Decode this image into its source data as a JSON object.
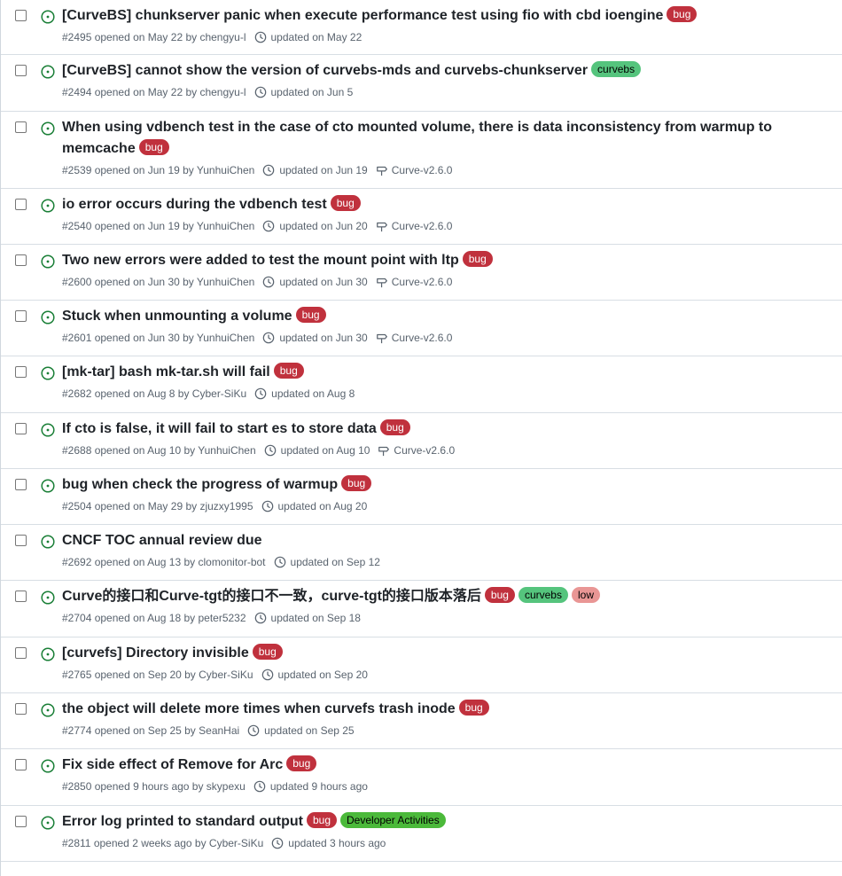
{
  "colors": {
    "open_icon": "#1a7f37",
    "bug_label_bg": "#c0313d",
    "curvebs_label_bg": "#55c47d",
    "low_label_bg": "#e99695",
    "dev_label_bg": "#4bb93a"
  },
  "issues": [
    {
      "title": "[CurveBS] chunkserver panic when execute performance test using fio with cbd ioengine",
      "labels": [
        "bug"
      ],
      "meta": "#2495 opened on May 22 by chengyu-l",
      "updated": "updated on May 22",
      "milestone": ""
    },
    {
      "title": "[CurveBS] cannot show the version of curvebs-mds and curvebs-chunkserver",
      "labels": [
        "curvebs"
      ],
      "meta": "#2494 opened on May 22 by chengyu-l",
      "updated": "updated on Jun 5",
      "milestone": ""
    },
    {
      "title": "When using vdbench test in the case of cto mounted volume, there is data inconsistency from warmup to memcache",
      "labels": [
        "bug"
      ],
      "meta": "#2539 opened on Jun 19 by YunhuiChen",
      "updated": "updated on Jun 19",
      "milestone": "Curve-v2.6.0"
    },
    {
      "title": "io error occurs during the vdbench test",
      "labels": [
        "bug"
      ],
      "meta": "#2540 opened on Jun 19 by YunhuiChen",
      "updated": "updated on Jun 20",
      "milestone": "Curve-v2.6.0"
    },
    {
      "title": "Two new errors were added to test the mount point with ltp",
      "labels": [
        "bug"
      ],
      "meta": "#2600 opened on Jun 30 by YunhuiChen",
      "updated": "updated on Jun 30",
      "milestone": "Curve-v2.6.0"
    },
    {
      "title": "Stuck when unmounting a volume",
      "labels": [
        "bug"
      ],
      "meta": "#2601 opened on Jun 30 by YunhuiChen",
      "updated": "updated on Jun 30",
      "milestone": "Curve-v2.6.0"
    },
    {
      "title": "[mk-tar] bash mk-tar.sh will fail",
      "labels": [
        "bug"
      ],
      "meta": "#2682 opened on Aug 8 by Cyber-SiKu",
      "updated": "updated on Aug 8",
      "milestone": ""
    },
    {
      "title": "If cto is false, it will fail to start es to store data",
      "labels": [
        "bug"
      ],
      "meta": "#2688 opened on Aug 10 by YunhuiChen",
      "updated": "updated on Aug 10",
      "milestone": "Curve-v2.6.0"
    },
    {
      "title": "bug when check the progress of warmup",
      "labels": [
        "bug"
      ],
      "meta": "#2504 opened on May 29 by zjuzxy1995",
      "updated": "updated on Aug 20",
      "milestone": ""
    },
    {
      "title": "CNCF TOC annual review due",
      "labels": [],
      "meta": "#2692 opened on Aug 13 by clomonitor-bot",
      "updated": "updated on Sep 12",
      "milestone": ""
    },
    {
      "title": "Curve的接口和Curve-tgt的接口不一致，curve-tgt的接口版本落后",
      "labels": [
        "bug",
        "curvebs",
        "low"
      ],
      "meta": "#2704 opened on Aug 18 by peter5232",
      "updated": "updated on Sep 18",
      "milestone": ""
    },
    {
      "title": "[curvefs] Directory invisible",
      "labels": [
        "bug"
      ],
      "meta": "#2765 opened on Sep 20 by Cyber-SiKu",
      "updated": "updated on Sep 20",
      "milestone": ""
    },
    {
      "title": "the object will delete more times when curvefs trash inode",
      "labels": [
        "bug"
      ],
      "meta": "#2774 opened on Sep 25 by SeanHai",
      "updated": "updated on Sep 25",
      "milestone": ""
    },
    {
      "title": "Fix side effect of Remove for Arc",
      "labels": [
        "bug"
      ],
      "meta": "#2850 opened 9 hours ago by skypexu",
      "updated": "updated 9 hours ago",
      "milestone": ""
    },
    {
      "title": "Error log printed to standard output",
      "labels": [
        "bug",
        "Developer Activities"
      ],
      "meta": "#2811 opened 2 weeks ago by Cyber-SiKu",
      "updated": "updated 3 hours ago",
      "milestone": ""
    }
  ]
}
